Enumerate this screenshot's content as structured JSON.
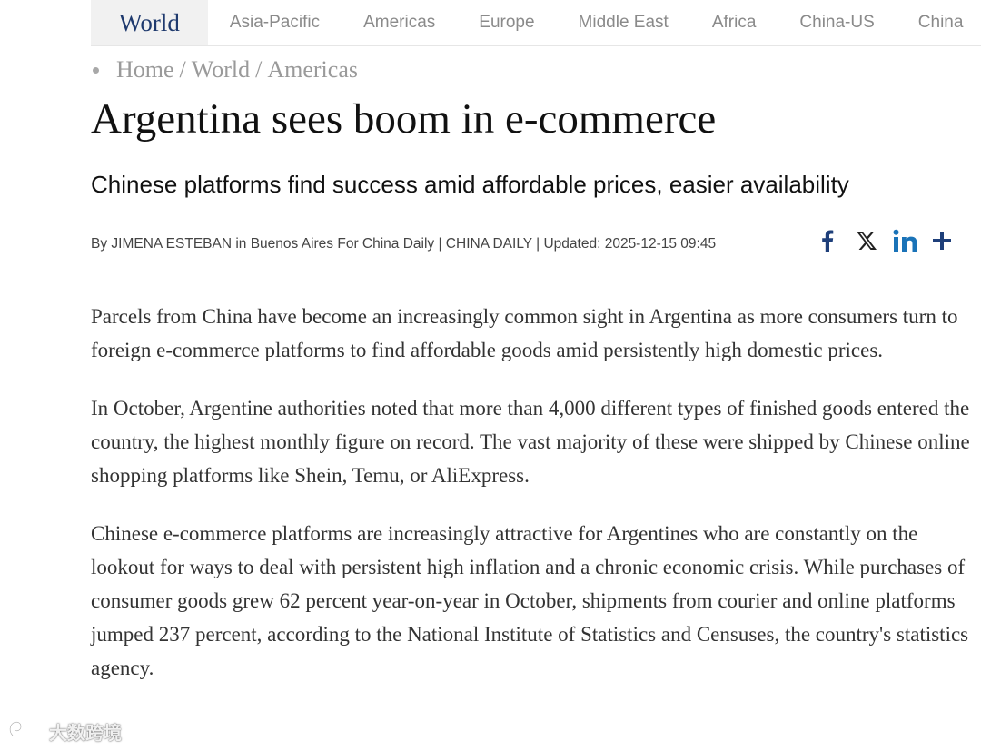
{
  "nav": {
    "items": [
      {
        "label": "World",
        "active": true
      },
      {
        "label": "Asia-Pacific",
        "active": false
      },
      {
        "label": "Americas",
        "active": false
      },
      {
        "label": "Europe",
        "active": false
      },
      {
        "label": "Middle East",
        "active": false
      },
      {
        "label": "Africa",
        "active": false
      },
      {
        "label": "China-US",
        "active": false
      },
      {
        "label": "China",
        "active": false
      }
    ]
  },
  "breadcrumb": {
    "items": [
      "Home",
      "World",
      "Americas"
    ],
    "separator": "/"
  },
  "article": {
    "title": "Argentina sees boom in e-commerce",
    "subtitle": "Chinese platforms find success amid affordable prices, easier availability",
    "byline": "By JIMENA ESTEBAN in Buenos Aires For China Daily | CHINA DAILY | Updated: 2025-12-15 09:45",
    "paragraphs": [
      "Parcels from China have become an increasingly common sight in Argentina as more consumers turn to foreign e-commerce platforms to find affordable goods amid persistently high domestic prices.",
      "In October, Argentine authorities noted that more than 4,000 different types of finished goods entered the country, the highest monthly figure on record. The vast majority of these were shipped by Chinese online shopping platforms like Shein, Temu, or AliExpress.",
      "Chinese e-commerce platforms are increasingly attractive for Argentines who are constantly on the lookout for ways to deal with persistent high inflation and a chronic economic crisis. While purchases of consumer goods grew 62 percent year-on-year in October, shipments from courier and online platforms jumped 237 percent, according to the National Institute of Statistics and Censuses, the country's statistics agency."
    ]
  },
  "share": {
    "icons": [
      "facebook-icon",
      "x-icon",
      "linkedin-icon",
      "plus-icon"
    ],
    "colors": {
      "facebook": "#1e3f7a",
      "x": "#222222",
      "linkedin": "#1a73b8",
      "plus": "#1e3f7a"
    }
  },
  "watermark": {
    "text": "大数跨境",
    "icon": "watermark-logo-icon"
  },
  "colors": {
    "accent": "#1f3a6e",
    "nav_active_bg": "#f1f1f1",
    "muted": "#9a9a9a",
    "body_text": "#333333"
  }
}
